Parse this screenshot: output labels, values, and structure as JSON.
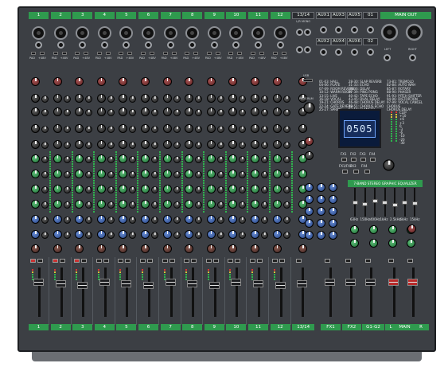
{
  "mixer": {
    "channels": [
      "1",
      "2",
      "3",
      "4",
      "5",
      "6",
      "7",
      "8",
      "9",
      "10",
      "11",
      "12"
    ],
    "stereo_channel": "13/14",
    "stereo_sub": "L/R MONO",
    "aux_heads": [
      "AUX1",
      "AUX3",
      "AUX5",
      "01"
    ],
    "aux_heads_2": [
      "AUX2",
      "AUX4",
      "AUX6",
      "02"
    ],
    "main_out": "MAIN OUT",
    "main_out_lr": [
      "LEFT",
      "RIGHT"
    ],
    "pad_label": "PAD",
    "rev_label": "+48V",
    "bottom_labels": [
      "1",
      "2",
      "3",
      "4",
      "5",
      "6",
      "7",
      "8",
      "9",
      "10",
      "11",
      "12",
      "13/14",
      "FX1",
      "FX2",
      "G1-G2",
      "L",
      "MAIN",
      "R"
    ],
    "fx_panel": {
      "usb_label": "USB",
      "program_label": "PROGRAM",
      "effects_col1": [
        "01-03: HALL",
        "04-06: PLATE",
        "07-09: ROOM REVERB",
        "10-12: WARM ROOM",
        "13-15: LIVE",
        "16-18: VOCAL",
        "19-21: CHORUS",
        "22-24: GATE REVERB",
        "25-27: SPRING"
      ],
      "effects_col2": [
        "28-30: SLAP REVERB",
        "31-33: ECHO",
        "34-36: DELAY",
        "37-39: PING PONG",
        "40-42: TAPE ECHO",
        "43-45: DUAL DELAY",
        "46-48: CHORUS DELAY",
        "49-51: CHORUS ECHO",
        "52-54: FLANGER"
      ],
      "effects_col3": [
        "73-81: TREMOLO",
        "82-84: AUTO WAH",
        "85-87: ROTARY",
        "88-90: PHASER",
        "91-93: PITCH SHIFTER",
        "94-96: DISTORTION",
        "97-99: VOCAL CANCEL",
        "CHORUS",
        "CHORUS DELAY"
      ],
      "display_value": "0505",
      "fx_buttons": [
        "FX1",
        "FX2",
        "FX3",
        "FX4"
      ],
      "fx_buttons_2": [
        "FX1/FX2",
        "FX3",
        "FX4"
      ]
    },
    "graphic_eq": {
      "title": "7-BAND STEREO GRAPHIC EQUALIZER",
      "bands": [
        "63Hz",
        "150Hz",
        "400Hz",
        "1kHz",
        "2.5kHz",
        "6kHz",
        "15kHz"
      ],
      "levels": [
        0.5,
        0.42,
        0.55,
        0.48,
        0.4,
        0.5,
        0.45
      ]
    },
    "meter_labels": [
      "CLIP",
      "+10",
      "+6",
      "+3",
      "0",
      "-3",
      "-6",
      "-10",
      "-20",
      "-30"
    ]
  }
}
